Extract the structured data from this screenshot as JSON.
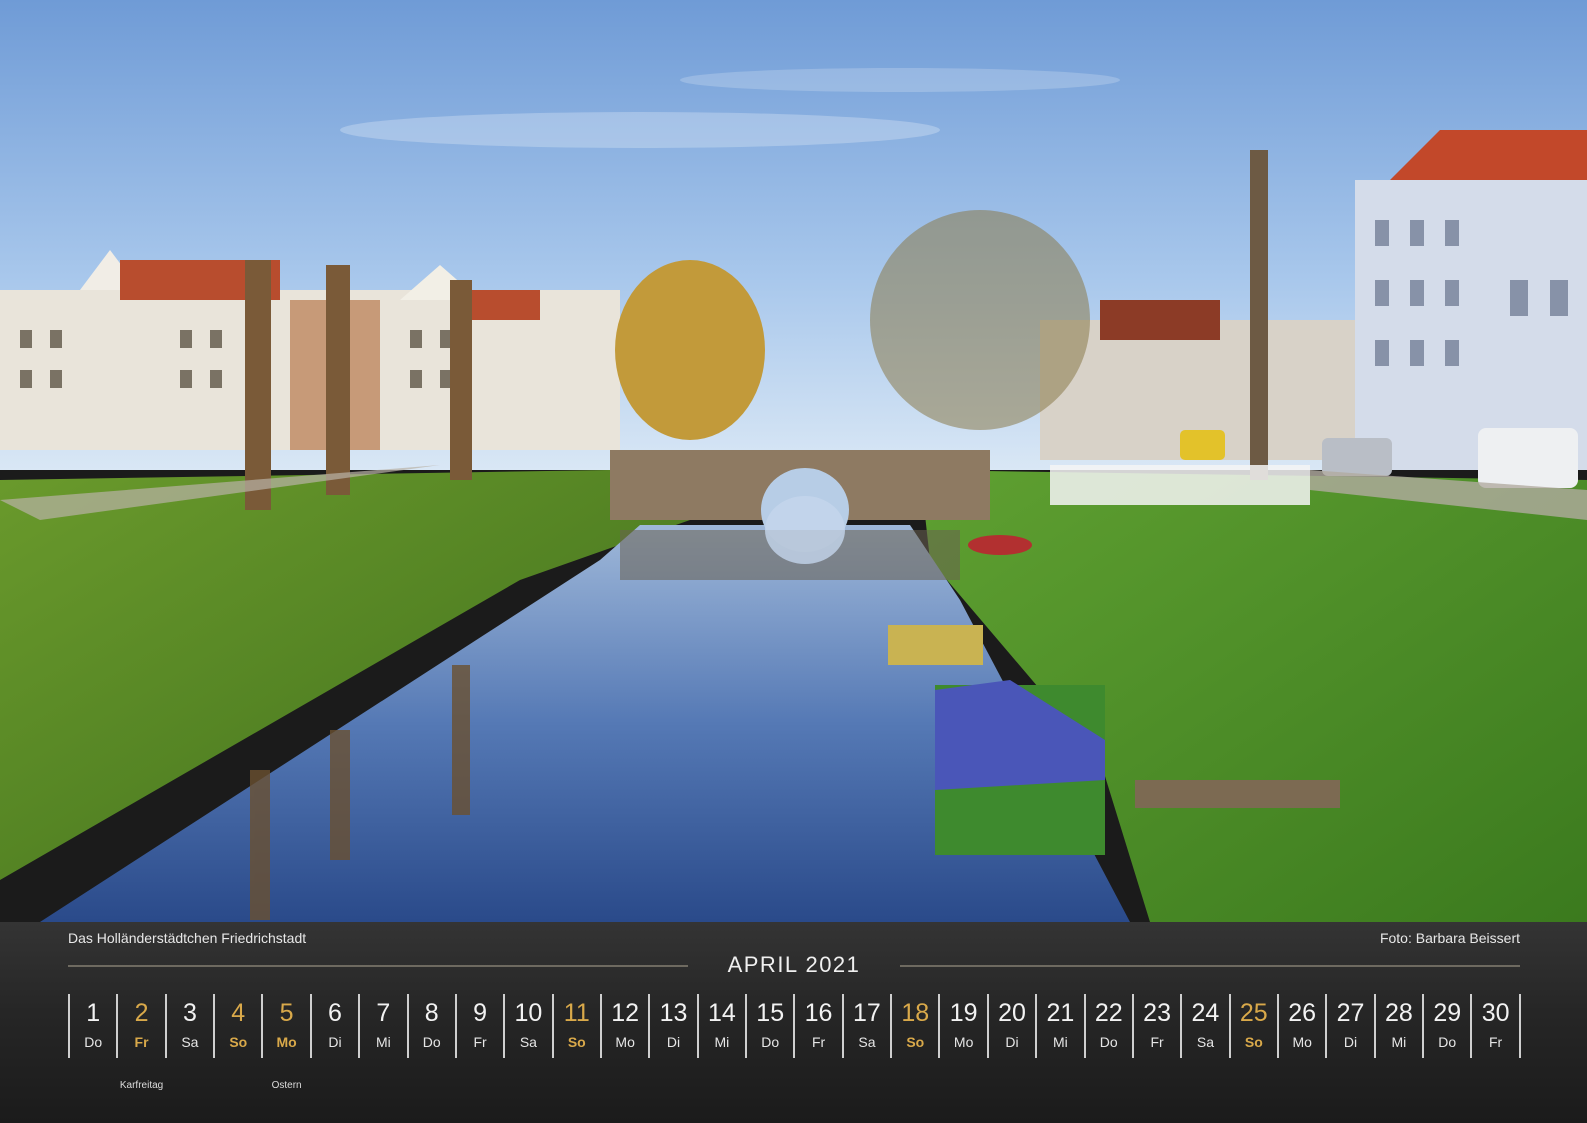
{
  "caption": {
    "title": "Das Holländerstädtchen Friedrichstadt",
    "credit": "Foto: Barbara Beissert"
  },
  "calendar": {
    "month_title": "APRIL 2021",
    "highlight_color": "#d9a94a",
    "days": [
      {
        "num": "1",
        "weekday": "Do",
        "highlight": false
      },
      {
        "num": "2",
        "weekday": "Fr",
        "highlight": true,
        "note": "Karfreitag"
      },
      {
        "num": "3",
        "weekday": "Sa",
        "highlight": false
      },
      {
        "num": "4",
        "weekday": "So",
        "highlight": true
      },
      {
        "num": "5",
        "weekday": "Mo",
        "highlight": true,
        "note": "Ostern"
      },
      {
        "num": "6",
        "weekday": "Di",
        "highlight": false
      },
      {
        "num": "7",
        "weekday": "Mi",
        "highlight": false
      },
      {
        "num": "8",
        "weekday": "Do",
        "highlight": false
      },
      {
        "num": "9",
        "weekday": "Fr",
        "highlight": false
      },
      {
        "num": "10",
        "weekday": "Sa",
        "highlight": false
      },
      {
        "num": "11",
        "weekday": "So",
        "highlight": true
      },
      {
        "num": "12",
        "weekday": "Mo",
        "highlight": false
      },
      {
        "num": "13",
        "weekday": "Di",
        "highlight": false
      },
      {
        "num": "14",
        "weekday": "Mi",
        "highlight": false
      },
      {
        "num": "15",
        "weekday": "Do",
        "highlight": false
      },
      {
        "num": "16",
        "weekday": "Fr",
        "highlight": false
      },
      {
        "num": "17",
        "weekday": "Sa",
        "highlight": false
      },
      {
        "num": "18",
        "weekday": "So",
        "highlight": true
      },
      {
        "num": "19",
        "weekday": "Mo",
        "highlight": false
      },
      {
        "num": "20",
        "weekday": "Di",
        "highlight": false
      },
      {
        "num": "21",
        "weekday": "Mi",
        "highlight": false
      },
      {
        "num": "22",
        "weekday": "Do",
        "highlight": false
      },
      {
        "num": "23",
        "weekday": "Fr",
        "highlight": false
      },
      {
        "num": "24",
        "weekday": "Sa",
        "highlight": false
      },
      {
        "num": "25",
        "weekday": "So",
        "highlight": true
      },
      {
        "num": "26",
        "weekday": "Mo",
        "highlight": false
      },
      {
        "num": "27",
        "weekday": "Di",
        "highlight": false
      },
      {
        "num": "28",
        "weekday": "Mi",
        "highlight": false
      },
      {
        "num": "29",
        "weekday": "Do",
        "highlight": false
      },
      {
        "num": "30",
        "weekday": "Fr",
        "highlight": false
      }
    ]
  }
}
